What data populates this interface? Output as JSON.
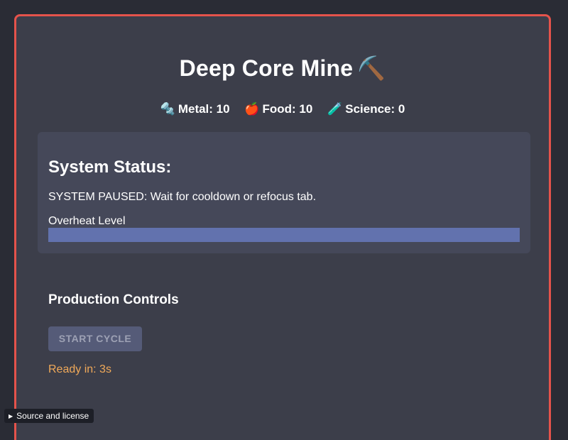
{
  "game": {
    "title": "Deep Core Mine",
    "title_icon": "⛏️"
  },
  "resources": [
    {
      "icon_name": "bolt-icon",
      "icon": "🔩",
      "label": "Metal: 10"
    },
    {
      "icon_name": "apple-icon",
      "icon": "🍎",
      "label": "Food: 10"
    },
    {
      "icon_name": "test-tube-icon",
      "icon": "🧪",
      "label": "Science: 0"
    }
  ],
  "status": {
    "heading": "System Status:",
    "message": "SYSTEM PAUSED: Wait for cooldown or refocus tab.",
    "overheat_label": "Overheat Level",
    "overheat_value_percent": 0
  },
  "controls": {
    "heading": "Production Controls",
    "start_label": "START CYCLE",
    "start_enabled": false,
    "ready_text": "Ready in: 3s"
  },
  "footer": {
    "toggle": "▶",
    "source_label": "Source and license"
  },
  "colors": {
    "frame_border": "#e5534b",
    "panel_bg": "#3c3e4a",
    "status_bg": "#454859",
    "bar_track": "#6272ae",
    "ready_text": "#f0a959",
    "button_disabled_bg": "#555b78"
  }
}
